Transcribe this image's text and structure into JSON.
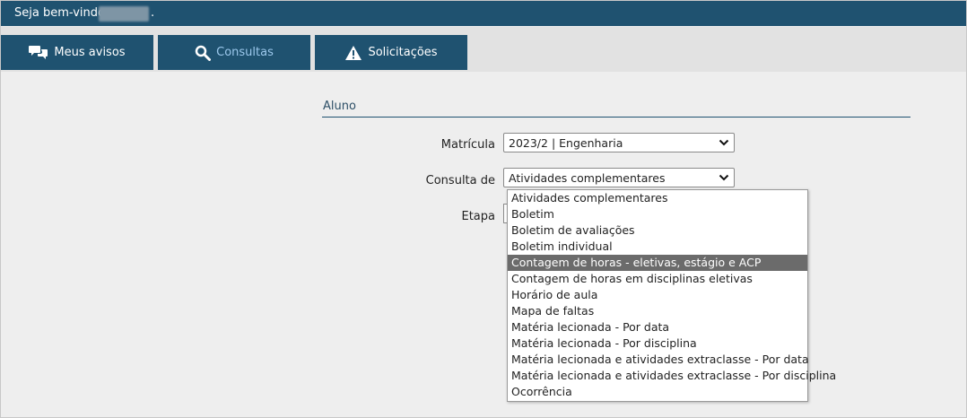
{
  "header": {
    "welcome": "Seja bem-vindo",
    "suffix": "."
  },
  "tabs": [
    {
      "label": "Meus avisos",
      "icon": "chat-bubbles-icon",
      "active": false
    },
    {
      "label": "Consultas",
      "icon": "search-icon",
      "active": true
    },
    {
      "label": "Solicitações",
      "icon": "warning-icon",
      "active": false
    }
  ],
  "section": {
    "title": "Aluno"
  },
  "form": {
    "matricula": {
      "label": "Matrícula",
      "value": "2023/2 | Engenharia"
    },
    "consulta": {
      "label": "Consulta de",
      "value": "Atividades complementares"
    },
    "etapa": {
      "label": "Etapa"
    }
  },
  "dropdown": {
    "options": [
      "Atividades complementares",
      "Boletim",
      "Boletim de avaliações",
      "Boletim individual",
      "Contagem de horas - eletivas, estágio e ACP",
      "Contagem de horas em disciplinas eletivas",
      "Horário de aula",
      "Mapa de faltas",
      "Matéria lecionada - Por data",
      "Matéria lecionada - Por disciplina",
      "Matéria lecionada e atividades extraclasse - Por data",
      "Matéria lecionada e atividades extraclasse - Por disciplina",
      "Ocorrência"
    ],
    "highlighted_index": 4
  },
  "colors": {
    "primary": "#1f5270",
    "active_tab_text": "#9cc8ec",
    "highlight": "#6b6b6b",
    "background": "#eeeeee"
  }
}
